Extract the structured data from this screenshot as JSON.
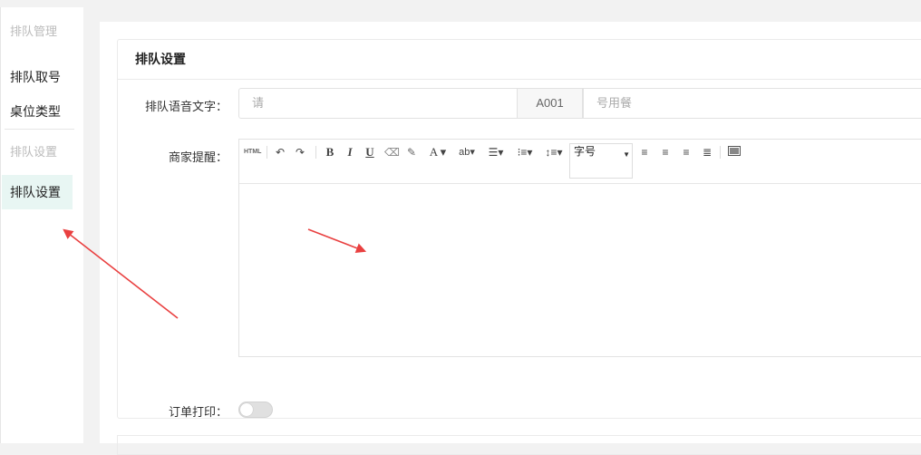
{
  "sidebar": {
    "group1": "排队管理",
    "items1": [
      "排队取号",
      "桌位类型"
    ],
    "group2": "排队设置",
    "active_item": "排队设置"
  },
  "card": {
    "title": "排队设置"
  },
  "form": {
    "voice_label": "排队语音文字：",
    "voice_prefix_placeholder": "请",
    "voice_addon": "A001",
    "voice_suffix_placeholder": "号用餐",
    "reminder_label": "商家提醒：",
    "print_label": "订单打印：",
    "print_enabled": false
  },
  "editor": {
    "font_size_label": "字号",
    "toolbar": [
      "html-icon",
      "undo-icon",
      "redo-icon",
      "bold-icon",
      "italic-icon",
      "underline-icon",
      "eraser-icon",
      "brush-icon",
      "font-color-icon",
      "highlight-icon",
      "ordered-list-icon",
      "unordered-list-icon",
      "line-height-icon",
      "align-left-icon",
      "align-right-icon",
      "align-center-icon",
      "align-justify-icon",
      "image-icon"
    ]
  },
  "annotation": {
    "arrow_color": "#e94040"
  },
  "colors": {
    "active_bg": "#e8f6f3"
  }
}
